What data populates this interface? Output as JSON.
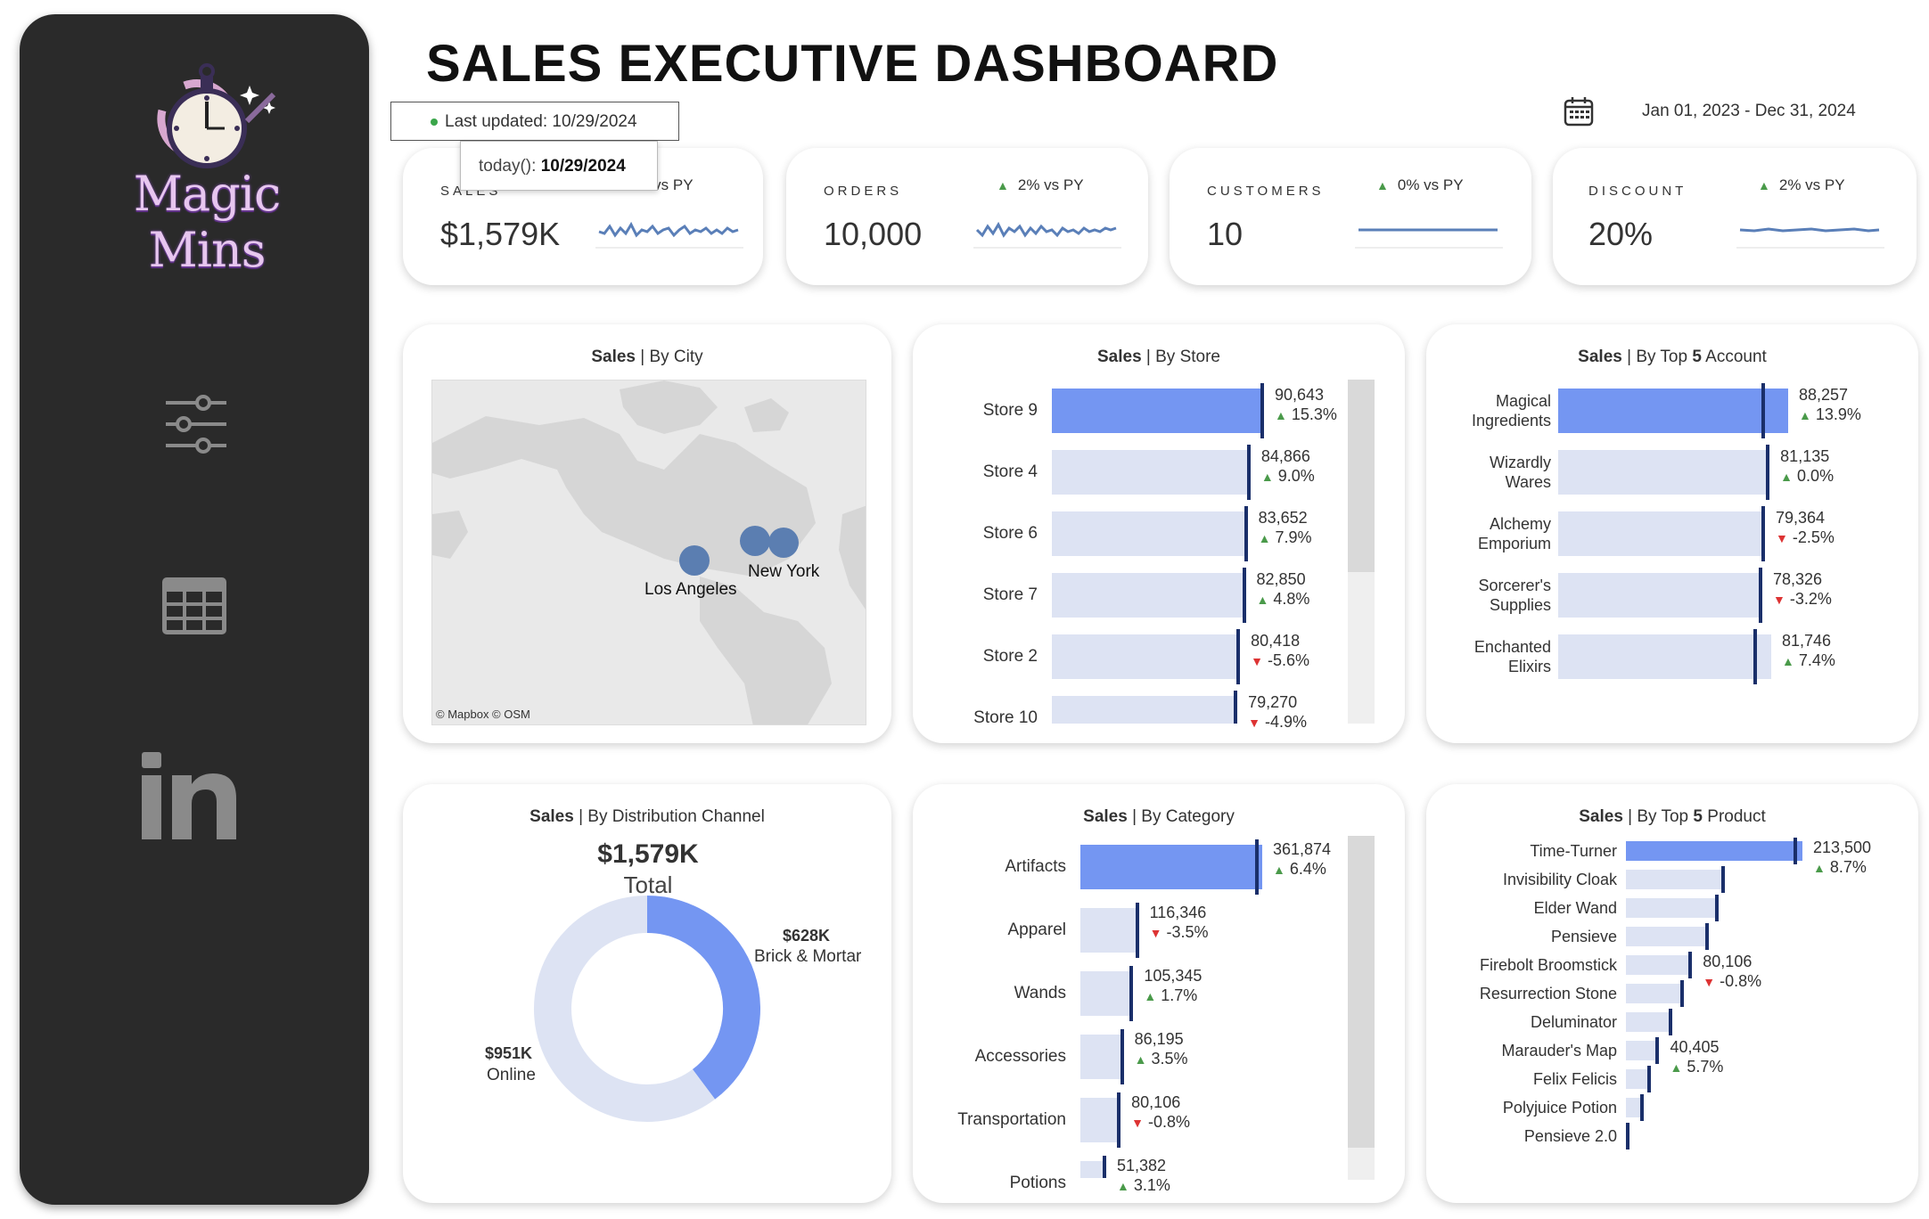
{
  "brand": {
    "name": "Magic Mins"
  },
  "header": {
    "title": "SALES EXECUTIVE DASHBOARD",
    "last_updated": "Last updated: 10/29/2024",
    "tooltip_prefix": "today():",
    "tooltip_value": "10/29/2024",
    "date_range": "Jan 01, 2023 - Dec 31, 2024"
  },
  "kpis": [
    {
      "label": "SALES",
      "value": "$1,579K",
      "delta": "2% vs PY"
    },
    {
      "label": "ORDERS",
      "value": "10,000",
      "delta": "2% vs PY"
    },
    {
      "label": "CUSTOMERS",
      "value": "10",
      "delta": "0% vs PY"
    },
    {
      "label": "DISCOUNT",
      "value": "20%",
      "delta": "2% vs PY"
    }
  ],
  "panels": {
    "city": {
      "bold": "Sales",
      "rest": "| By City",
      "cities": [
        "Los Angeles",
        "New York"
      ],
      "credit": "© Mapbox  © OSM"
    },
    "store": {
      "bold": "Sales",
      "rest": "| By Store"
    },
    "account": {
      "bold": "Sales",
      "rest": "| By Top",
      "bold2": "5",
      "rest2": "Account"
    },
    "channel": {
      "bold": "Sales",
      "rest": "| By Distribution Channel",
      "total_value": "$1,579K",
      "total_label": "Total",
      "brick_value": "$628K",
      "brick_label": "Brick & Mortar",
      "online_value": "$951K",
      "online_label": "Online"
    },
    "category": {
      "bold": "Sales",
      "rest": "| By Category"
    },
    "product": {
      "bold": "Sales",
      "rest": "| By Top",
      "bold2": "5",
      "rest2": "Product"
    }
  },
  "colors": {
    "accent": "#7496f2",
    "bar_bg": "#dde3f3",
    "marker": "#1a2f6a",
    "up": "#4a9a4a",
    "down": "#dd3333",
    "sidebar": "#2a2a2a"
  },
  "chart_data": [
    {
      "type": "bar",
      "title": "Sales | By Store",
      "categories": [
        "Store 9",
        "Store 4",
        "Store 6",
        "Store 7",
        "Store 2",
        "Store 10"
      ],
      "values": [
        90643,
        84866,
        83652,
        82850,
        80418,
        79270
      ],
      "deltas": [
        "15.3%",
        "9.0%",
        "7.9%",
        "4.8%",
        "-5.6%",
        "-4.9%"
      ],
      "delta_dir": [
        "up",
        "up",
        "up",
        "up",
        "down",
        "down"
      ],
      "labels": [
        "90,643",
        "84,866",
        "83,652",
        "82,850",
        "80,418",
        "79,270"
      ]
    },
    {
      "type": "bar",
      "title": "Sales | By Top 5 Account",
      "categories": [
        "Magical Ingredients",
        "Wizardly Wares",
        "Alchemy Emporium",
        "Sorcerer's Supplies",
        "Enchanted Elixirs"
      ],
      "values": [
        88257,
        81135,
        79364,
        78326,
        81746
      ],
      "deltas": [
        "13.9%",
        "0.0%",
        "-2.5%",
        "-3.2%",
        "7.4%"
      ],
      "delta_dir": [
        "up",
        "up",
        "down",
        "down",
        "up"
      ],
      "labels": [
        "88,257",
        "81,135",
        "79,364",
        "78,326",
        "81,746"
      ]
    },
    {
      "type": "bar",
      "title": "Sales | By Category",
      "categories": [
        "Artifacts",
        "Apparel",
        "Wands",
        "Accessories",
        "Transportation",
        "Potions"
      ],
      "values": [
        361874,
        116346,
        105345,
        86195,
        80106,
        51382
      ],
      "deltas": [
        "6.4%",
        "-3.5%",
        "1.7%",
        "3.5%",
        "-0.8%",
        "3.1%"
      ],
      "delta_dir": [
        "up",
        "down",
        "up",
        "up",
        "down",
        "up"
      ],
      "labels": [
        "361,874",
        "116,346",
        "105,345",
        "86,195",
        "80,106",
        "51,382"
      ]
    },
    {
      "type": "bar",
      "title": "Sales | By Top 5 Product",
      "categories": [
        "Time-Turner",
        "Invisibility Cloak",
        "Elder Wand",
        "Pensieve",
        "Firebolt Broomstick",
        "Resurrection Stone",
        "Deluminator",
        "Marauder's Map",
        "Felix Felicis",
        "Polyjuice Potion",
        "Pensieve 2.0"
      ],
      "values": [
        213500,
        120000,
        112000,
        100000,
        80106,
        70000,
        56000,
        40405,
        30000,
        22000,
        0
      ],
      "labels": [
        "213,500",
        "",
        "",
        "",
        "80,106",
        "",
        "",
        "40,405",
        "",
        "",
        ""
      ],
      "deltas": [
        "8.7%",
        "",
        "",
        "",
        "-0.8%",
        "",
        "",
        "5.7%",
        "",
        "",
        ""
      ],
      "delta_dir": [
        "up",
        "",
        "",
        "",
        "down",
        "",
        "",
        "up",
        "",
        "",
        ""
      ]
    },
    {
      "type": "pie",
      "title": "Sales | By Distribution Channel",
      "categories": [
        "Brick & Mortar",
        "Online"
      ],
      "values": [
        628,
        951
      ],
      "unit": "$K"
    }
  ]
}
